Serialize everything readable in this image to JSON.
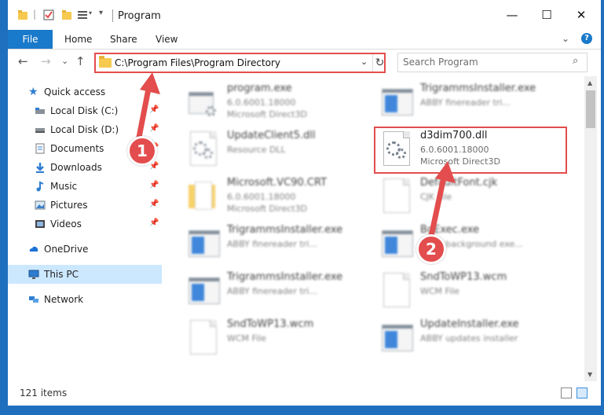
{
  "window": {
    "title": "Program",
    "controls": {
      "minimize": "—",
      "maximize": "☐",
      "close": "✕"
    }
  },
  "ribbon": {
    "tabs": {
      "file": "File",
      "home": "Home",
      "share": "Share",
      "view": "View"
    },
    "collapse_icon": "⌄",
    "help_icon": "?"
  },
  "address_bar": {
    "path": "C:\\Program Files\\Program Directory",
    "dropdown_icon": "⌄",
    "refresh_icon": "↻"
  },
  "search": {
    "placeholder": "Search Program",
    "icon": "⌕"
  },
  "nav_buttons": {
    "back": "←",
    "forward": "→",
    "recent": "⌄",
    "up": "↑"
  },
  "sidebar": {
    "quick_access": "Quick access",
    "items": [
      {
        "label": "Local Disk (C:)",
        "icon": "drive-icon",
        "pinned": true
      },
      {
        "label": "Local Disk (D:)",
        "icon": "drive-icon",
        "pinned": true
      },
      {
        "label": "Documents",
        "icon": "documents-icon",
        "pinned": true
      },
      {
        "label": "Downloads",
        "icon": "downloads-icon",
        "pinned": true
      },
      {
        "label": "Music",
        "icon": "music-icon",
        "pinned": true
      },
      {
        "label": "Pictures",
        "icon": "pictures-icon",
        "pinned": true
      },
      {
        "label": "Videos",
        "icon": "videos-icon",
        "pinned": true
      }
    ],
    "pin_glyph": "📌",
    "onedrive": "OneDrive",
    "this_pc": "This PC",
    "network": "Network"
  },
  "files": [
    {
      "name": "program.exe",
      "line2": "6.0.6001.18000",
      "line3": "Microsoft Direct3D",
      "icon": "exe-icon"
    },
    {
      "name": "TrigrammsInstaller.exe",
      "line2": "ABBY finereader tri...",
      "line3": "",
      "icon": "app-icon"
    },
    {
      "name": "UpdateClient5.dll",
      "line2": "Resource DLL",
      "line3": "",
      "icon": "dll-icon"
    },
    {
      "name": "d3dim700.dll",
      "line2": "6.0.6001.18000",
      "line3": "Microsoft Direct3D",
      "icon": "dll-icon"
    },
    {
      "name": "Microsoft.VC90.CRT",
      "line2": "6.0.6001.18000",
      "line3": "Microsoft Direct3D",
      "icon": "folder-icon"
    },
    {
      "name": "DefaultFont.cjk",
      "line2": "CJK File",
      "line3": "",
      "icon": "file-icon"
    },
    {
      "name": "TrigrammsInstaller.exe",
      "line2": "ABBY finereader tri...",
      "line3": "",
      "icon": "app-icon"
    },
    {
      "name": "BgExec.exe",
      "line2": "ABBY background exe...",
      "line3": "",
      "icon": "app-icon"
    },
    {
      "name": "TrigrammsInstaller.exe",
      "line2": "ABBY finereader tri...",
      "line3": "",
      "icon": "app-icon"
    },
    {
      "name": "SndToWP13.wcm",
      "line2": "WCM File",
      "line3": "",
      "icon": "file-icon"
    },
    {
      "name": "SndToWP13.wcm",
      "line2": "WCM File",
      "line3": "",
      "icon": "file-icon"
    },
    {
      "name": "UpdateInstaller.exe",
      "line2": "ABBY updates installer",
      "line3": "",
      "icon": "app-icon"
    }
  ],
  "status_bar": {
    "item_count": "121 items"
  },
  "annotations": {
    "step1": "1",
    "step2": "2",
    "color": "#e34d4d"
  },
  "colors": {
    "accent": "#1979ca",
    "desktop": "#1f6fbf",
    "selection": "#cce8ff"
  }
}
